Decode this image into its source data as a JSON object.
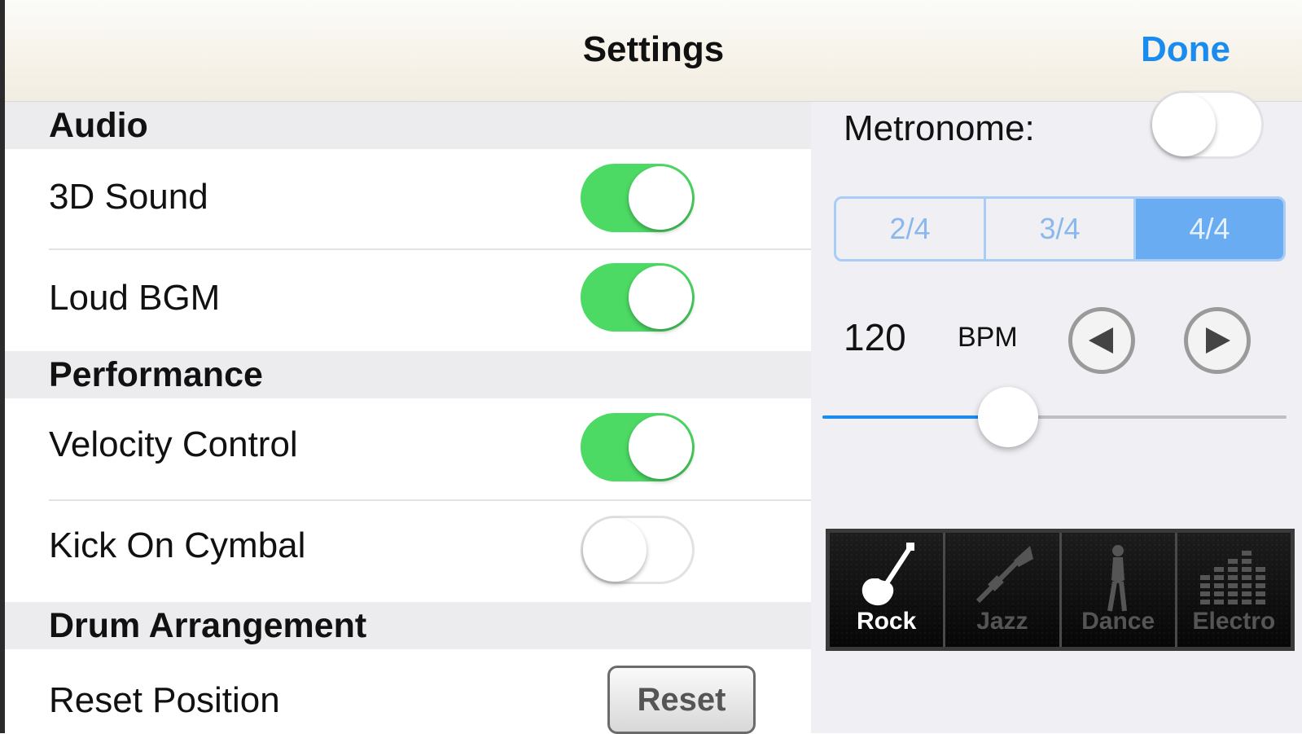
{
  "navbar": {
    "title": "Settings",
    "done_label": "Done"
  },
  "sections": {
    "audio": "Audio",
    "performance": "Performance",
    "drum_arrangement": "Drum Arrangement"
  },
  "settings": {
    "sound_3d": {
      "label": "3D Sound",
      "on": true
    },
    "loud_bgm": {
      "label": "Loud BGM",
      "on": true
    },
    "velocity_control": {
      "label": "Velocity Control",
      "on": true
    },
    "kick_on_cymbal": {
      "label": "Kick On Cymbal",
      "on": false
    },
    "reset_position": {
      "label": "Reset Position",
      "button_label": "Reset"
    }
  },
  "metronome": {
    "label": "Metronome:",
    "on": false,
    "time_signatures": [
      "2/4",
      "3/4",
      "4/4"
    ],
    "selected_time_signature": "4/4",
    "bpm_value": "120",
    "bpm_unit": "BPM",
    "tempo_slider_fraction": 0.4
  },
  "styles": {
    "items": [
      "Rock",
      "Jazz",
      "Dance",
      "Electro"
    ],
    "selected": "Rock"
  },
  "colors": {
    "accent": "#1a8cf0",
    "toggle_on": "#4cd964",
    "segment_selected": "#6aacf2"
  },
  "icons": [
    "guitar-icon",
    "trumpet-icon",
    "dancer-icon",
    "equalizer-icon",
    "arrow-left-icon",
    "arrow-right-icon"
  ]
}
